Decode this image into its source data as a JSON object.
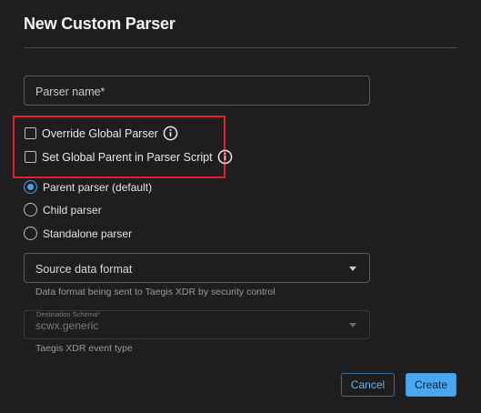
{
  "dialog": {
    "title": "New Custom Parser"
  },
  "parser_name": {
    "placeholder": "Parser name*"
  },
  "options": {
    "override_global": {
      "label": "Override Global Parser",
      "checked": false,
      "icon": "info-icon"
    },
    "set_global_parent": {
      "label": "Set Global Parent in Parser Script",
      "checked": false,
      "icon": "info-icon"
    }
  },
  "parser_type": {
    "items": [
      {
        "label": "Parent parser (default)",
        "selected": true
      },
      {
        "label": "Child parser",
        "selected": false
      },
      {
        "label": "Standalone parser",
        "selected": false
      }
    ]
  },
  "source_format": {
    "label": "Source data format",
    "helper": "Data format being sent to Taegis XDR by security control"
  },
  "destination_schema": {
    "label": "Destination Schema*",
    "value": "scwx.generic",
    "helper": "Taegis XDR event type",
    "disabled": true
  },
  "actions": {
    "cancel_label": "Cancel",
    "create_label": "Create"
  },
  "colors": {
    "background": "#1e1e1f",
    "accent": "#4aa6ee",
    "highlight": "#e0202a"
  }
}
